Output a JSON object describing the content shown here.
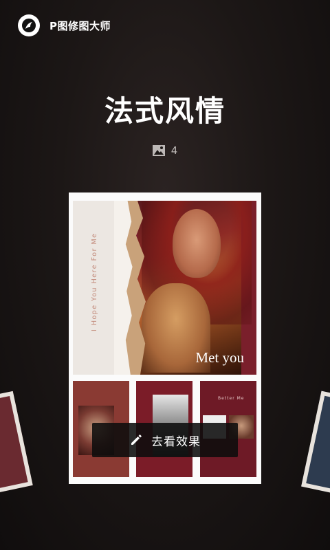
{
  "header": {
    "app_name": "P图修图大师",
    "logo_icon": "app-logo-icon"
  },
  "template": {
    "title": "法式风情",
    "image_count": "4",
    "image_icon": "image-icon"
  },
  "card": {
    "vertical_text": "I Hope You Here For Me",
    "caption": "Met you",
    "thumb3_label": "Better Me"
  },
  "action": {
    "label": "去看效果",
    "icon": "pencil-icon"
  }
}
